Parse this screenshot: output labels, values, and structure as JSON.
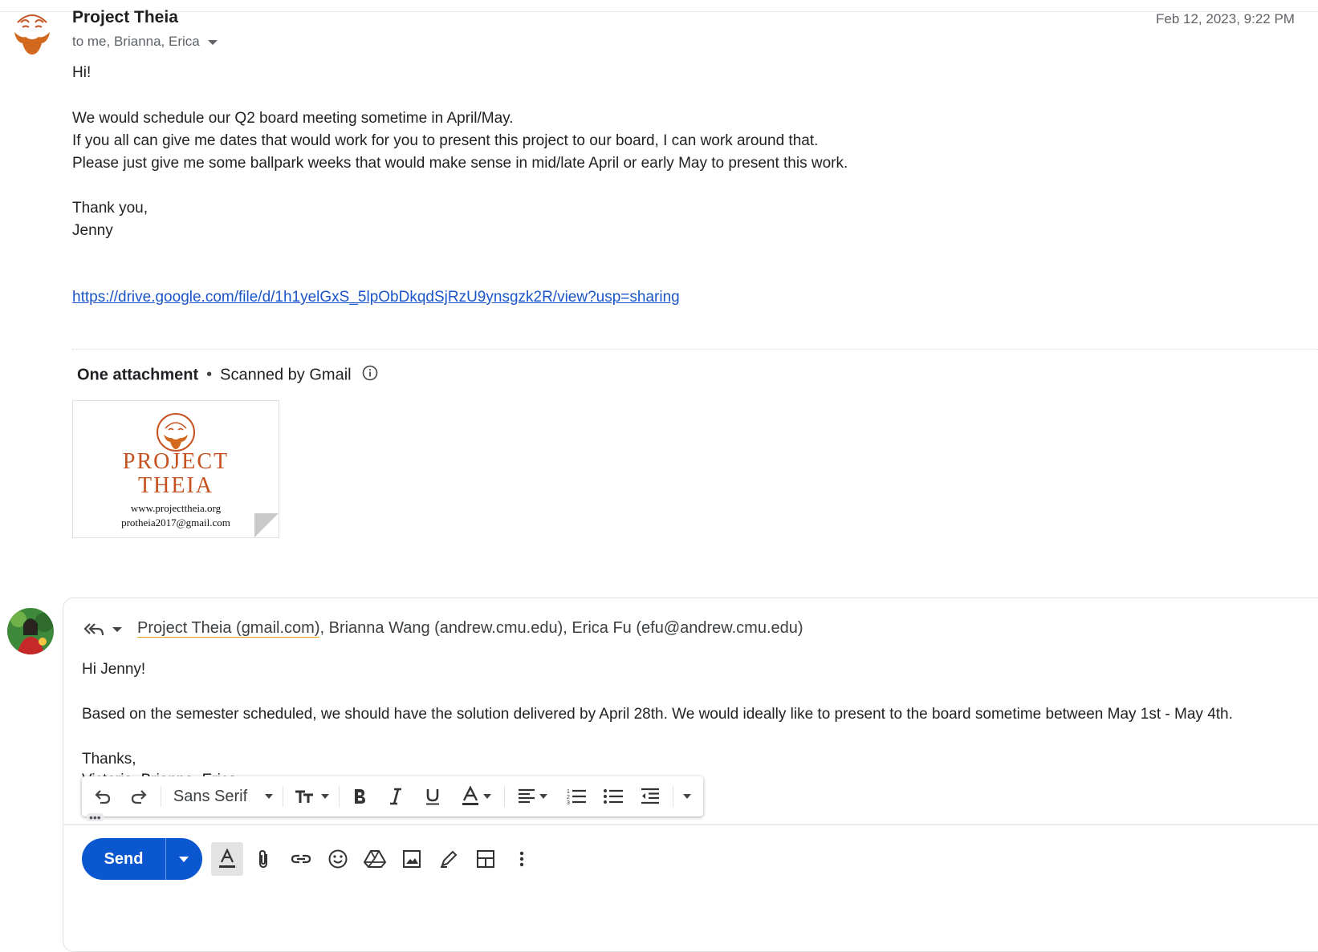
{
  "email": {
    "sender": "Project Theia",
    "recipients": "to me, Brianna, Erica",
    "date": "Feb 12, 2023, 9:22 PM",
    "body": {
      "greeting": "Hi!",
      "line1": "We would schedule our Q2 board meeting sometime in April/May.",
      "line2": "If you all can give me dates that would work for you to present this project to our board, I can work around that.",
      "line3": "Please just give me some ballpark weeks that would make sense in mid/late April or early May to present this work.",
      "signoff": "Thank you,",
      "signature": "Jenny",
      "link": "https://drive.google.com/file/d/1h1yelGxS_5lpObDkqdSjRzU9ynsgzk2R/view?usp=sharing"
    },
    "attachments": {
      "header": "One attachment",
      "scan_note": "Scanned by Gmail",
      "thumbnail": {
        "logo_line1": "PROJECT",
        "logo_line2": "THEIA",
        "website": "www.projecttheia.org",
        "email": "protheia2017@gmail.com"
      }
    }
  },
  "reply": {
    "to_first": "Project Theia (gmail.com)",
    "to_rest": ", Brianna Wang (andrew.cmu.edu), Erica Fu (efu@andrew.cmu.edu)",
    "greeting": "Hi Jenny!",
    "line1": "Based on the semester scheduled, we should have the solution delivered by April 28th. We would ideally like to present to the board sometime between May 1st - May 4th.",
    "signoff": "Thanks,",
    "cut_line": "Victoria, Brianna, Erica",
    "more_indicator": "•••"
  },
  "toolbar": {
    "font": "Sans Serif",
    "items": [
      "undo-icon",
      "redo-icon",
      "font-select",
      "text-size-icon",
      "bold-icon",
      "italic-icon",
      "underline-icon",
      "text-color-icon",
      "align-icon",
      "numbered-list-icon",
      "bulleted-list-icon",
      "indent-less-icon",
      "more-formatting-icon"
    ]
  },
  "actions": {
    "send_label": "Send",
    "icons": [
      "formatting-options-icon",
      "attach-icon",
      "link-icon",
      "emoji-icon",
      "drive-icon",
      "photo-icon",
      "signature-icon",
      "layouts-icon",
      "more-options-icon"
    ]
  },
  "colors": {
    "accent": "#0b57d0",
    "link": "#1a55c9",
    "brand": "#c5521f"
  }
}
